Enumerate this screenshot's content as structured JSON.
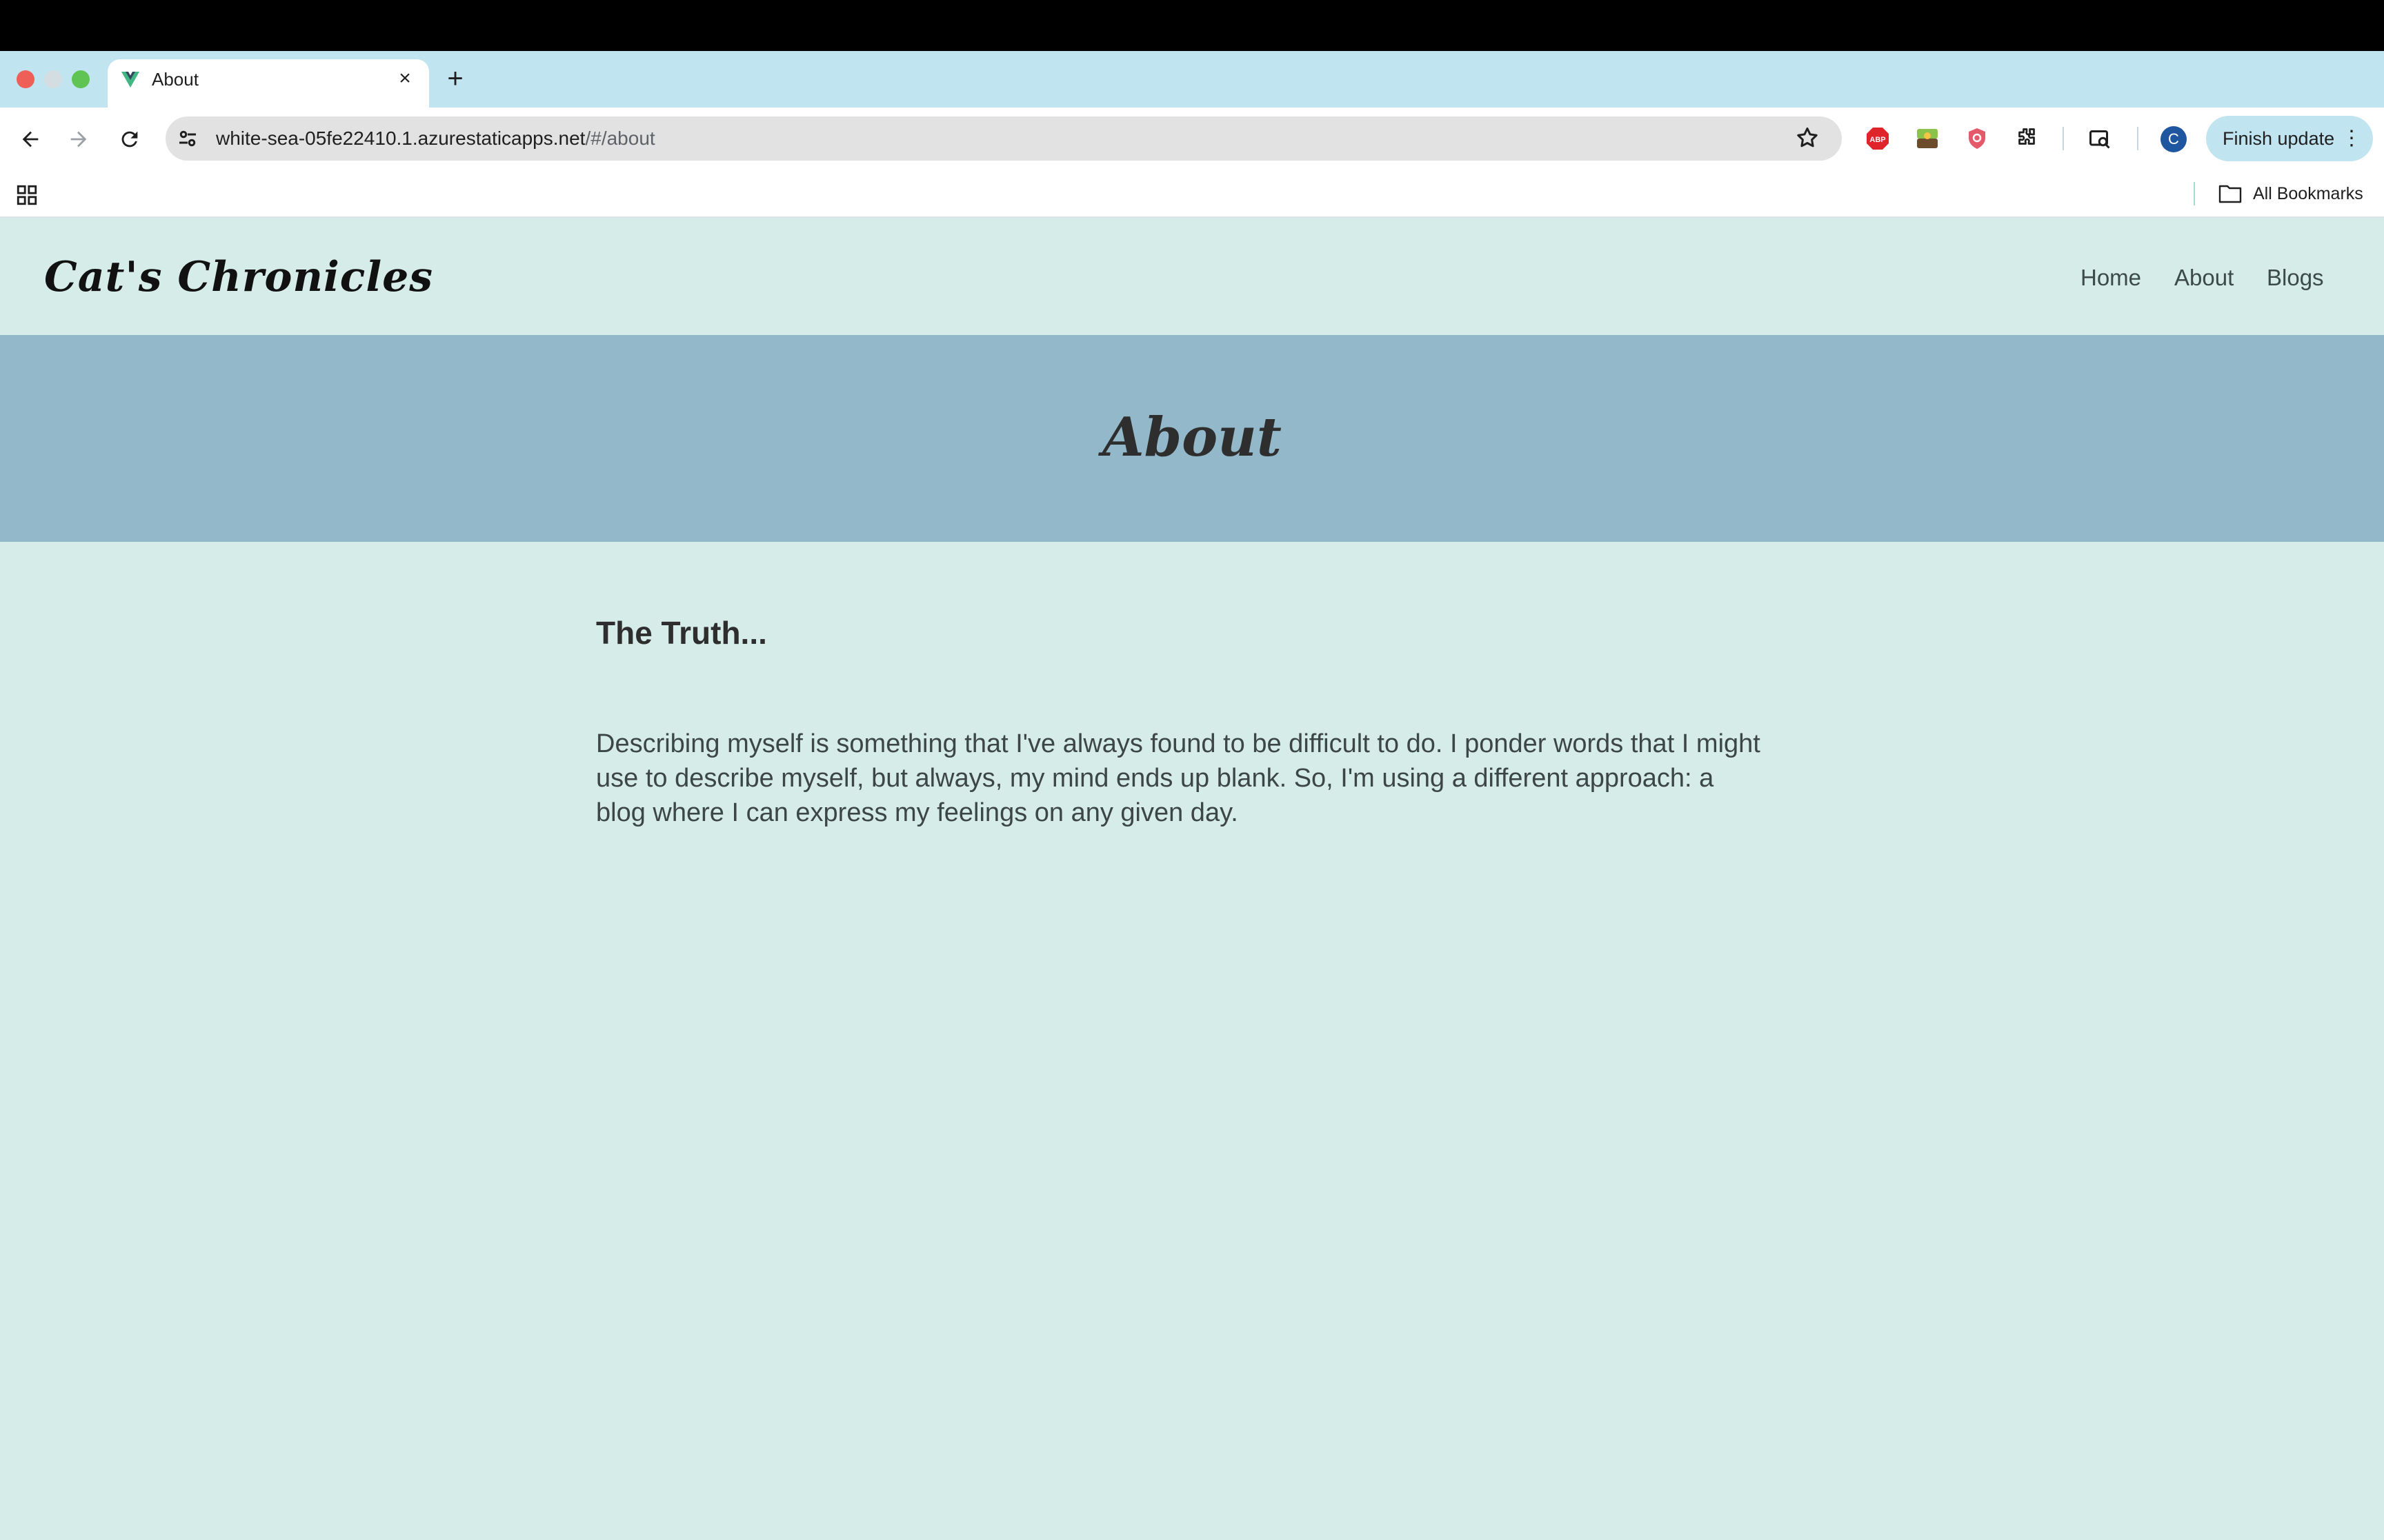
{
  "browser": {
    "tab_title": "About",
    "url_host": "white-sea-05fe22410.1.azurestaticapps.net",
    "url_path": "/#/about",
    "profile_initial": "C",
    "finish_update_label": "Finish update",
    "all_bookmarks_label": "All Bookmarks",
    "icons": {
      "back": "back-arrow-icon",
      "forward": "forward-arrow-icon",
      "reload": "reload-icon",
      "site_info": "tune-icon",
      "bookmark": "star-icon",
      "extensions": [
        "adblock-icon",
        "extension-green-icon",
        "shield-icon",
        "puzzle-icon",
        "cast-search-icon"
      ],
      "apps": "apps-grid-icon",
      "folder": "folder-icon"
    }
  },
  "site": {
    "brand": "Cat's Chronicles",
    "nav": {
      "home": "Home",
      "about": "About",
      "blogs": "Blogs"
    },
    "hero_title": "About",
    "section_heading": "The Truth...",
    "section_body": "Describing myself is something that I've always found to be difficult to do. I ponder words that I might use to describe myself, but always, my mind ends up blank. So, I'm using a different approach: a blog where I can express my feelings on any given day."
  },
  "colors": {
    "page_bg": "#d6ece8",
    "hero_bg": "#92b8c9",
    "tab_strip_bg": "#c1e5f0",
    "profile_bg": "#1e56a0"
  }
}
